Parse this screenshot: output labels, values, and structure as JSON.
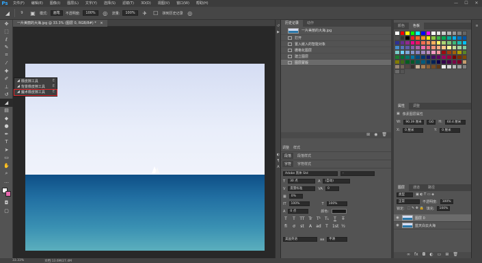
{
  "app": {
    "logo": "Ps"
  },
  "menu": [
    "文件(F)",
    "编辑(E)",
    "图像(I)",
    "图层(L)",
    "文字(Y)",
    "选择(S)",
    "滤镜(T)",
    "3D(D)",
    "视图(V)",
    "窗口(W)",
    "帮助(H)"
  ],
  "window_controls": [
    "—",
    "☐",
    "✕"
  ],
  "options": {
    "tool_icon": "eraser-icon",
    "size_value": "9",
    "mode_label": "模式:",
    "mode_value": "画笔",
    "opacity_label": "不透明度:",
    "opacity_value": "100%",
    "flow_label": "流量:",
    "flow_value": "100%",
    "erase_history_label": "抹到历史记录"
  },
  "document": {
    "tab_title": "一片美丽的大海.jpg @ 33.3% (图层 0, RGB/8#) *",
    "tab_close": "×"
  },
  "tools": [
    "move-icon",
    "marquee-icon",
    "lasso-icon",
    "quick-select-icon",
    "crop-icon",
    "eyedropper-icon",
    "healing-icon",
    "brush-icon",
    "clone-stamp-icon",
    "history-brush-icon",
    "eraser-icon",
    "gradient-icon",
    "blur-icon",
    "dodge-icon",
    "pen-icon",
    "type-icon",
    "path-select-icon",
    "rectangle-icon",
    "hand-icon",
    "zoom-icon",
    "more-icon"
  ],
  "flyout": {
    "items": [
      {
        "label": "橡皮擦工具",
        "shortcut": "E"
      },
      {
        "label": "背景橡皮擦工具",
        "shortcut": "E"
      },
      {
        "label": "魔术橡皮擦工具",
        "shortcut": "E"
      }
    ]
  },
  "status": {
    "zoom": "33.33%",
    "doc_info": "文档:13.6M/27.4M"
  },
  "history": {
    "tabs": [
      "历史记录",
      "动作"
    ],
    "snapshot": "一片美丽的大海.jpg",
    "items": [
      "打开",
      "置入嵌入的智能对象",
      "栅格化图层",
      "建立图层",
      "图层蒙版"
    ]
  },
  "mini_panels": {
    "adjust_tab": "调整",
    "styles_tab": "样式",
    "glyphs_tab": "字形",
    "paragraph_tab": "段落",
    "paragraph_tag": "段落样式",
    "character_tab": "字符",
    "char_style_tag": "字符样式"
  },
  "character": {
    "font_family": "Adobe 黑体 Std",
    "font_style": "-",
    "size": "30 点",
    "leading": "(自动)",
    "kerning": "度量标准",
    "tracking": "0",
    "scale_v": "100%",
    "scale_h": "100%",
    "baseline": "0 点",
    "color_label": "颜色:",
    "format_buttons": [
      "T",
      "T",
      "TT",
      "Tr",
      "T¹",
      "T₁",
      "T",
      "T̶"
    ],
    "opentype_buttons": [
      "fi",
      "ơ",
      "st",
      "A",
      "ad",
      "T",
      "1st",
      "½"
    ],
    "language": "美国英语",
    "aa_label": "aa",
    "antialias": "平滑"
  },
  "swatches": {
    "tabs": [
      "颜色",
      "色板"
    ],
    "colors": [
      "#ffffff",
      "#ff0000",
      "#ffff00",
      "#00ff00",
      "#00ffff",
      "#0000ff",
      "#ff00ff",
      "#ffffff",
      "#e6e6e6",
      "#cccccc",
      "#b3b3b3",
      "#999999",
      "#808080",
      "#666666",
      "#4d4d4d",
      "#333333",
      "#000000",
      "#ee1d24",
      "#f26522",
      "#f7941d",
      "#fff200",
      "#8dc63f",
      "#39b54a",
      "#00a651",
      "#00a99d",
      "#00aeef",
      "#0072bc",
      "#0054a6",
      "#2e3192",
      "#662d91",
      "#92278f",
      "#ec008c",
      "#ed145b",
      "#f26c4f",
      "#f68e56",
      "#fbaf5d",
      "#fff568",
      "#acd373",
      "#7cc576",
      "#3cb878",
      "#1cbbb4",
      "#00bff3",
      "#448ccb",
      "#5674b9",
      "#605ca8",
      "#8560a8",
      "#a864a8",
      "#f06eaa",
      "#f26d7d",
      "#f7977a",
      "#f9ad81",
      "#fdc689",
      "#fff79a",
      "#c4df9b",
      "#a3d39c",
      "#82ca9d",
      "#7accc8",
      "#6dcff6",
      "#7ea7d8",
      "#8493ca",
      "#8882be",
      "#a187be",
      "#bc8dbf",
      "#f49ac2",
      "#f5989d",
      "#9e0b0f",
      "#a0410d",
      "#a36209",
      "#aba000",
      "#598527",
      "#1a7b30",
      "#007236",
      "#00746b",
      "#0076a3",
      "#004a80",
      "#003471",
      "#1b1464",
      "#440e62",
      "#630460",
      "#9e005d",
      "#9e0039",
      "#790000",
      "#7b2e00",
      "#7d4900",
      "#827b00",
      "#406618",
      "#005e20",
      "#005826",
      "#005952",
      "#005b7f",
      "#003663",
      "#002157",
      "#0d004c",
      "#32004b",
      "#4b0049",
      "#7b0046",
      "#7a0026",
      "#c69c6d",
      "#998675",
      "#736357",
      "#534741",
      "#37302d",
      "#c7b299",
      "#a67c52",
      "#8c6239",
      "#754c24",
      "#603913",
      "#ebebeb",
      "#d4d4d4",
      "#bababa",
      "#9e9e9e",
      "#828282",
      "#6b6b6b",
      "#545454"
    ]
  },
  "properties": {
    "tabs": [
      "属性",
      "调整"
    ],
    "title": "像素图层属性",
    "w_label": "W:",
    "w_value": "90.39 厘米",
    "go_label": "GO",
    "h_label": "H:",
    "h_value": "60.4 厘米",
    "x_label": "X:",
    "x_value": "0 厘米",
    "y_label": "Y:",
    "y_value": "0 厘米"
  },
  "layers": {
    "tabs": [
      "图层",
      "通道",
      "路径"
    ],
    "filter_kind": "类型",
    "blend_mode": "正常",
    "opacity_label": "不透明度:",
    "opacity_value": "100%",
    "lock_label": "锁定:",
    "fill_label": "填充:",
    "fill_value": "100%",
    "items": [
      {
        "name": "图层 0",
        "active": true
      },
      {
        "name": "蓝天白云大海",
        "active": false
      }
    ]
  }
}
